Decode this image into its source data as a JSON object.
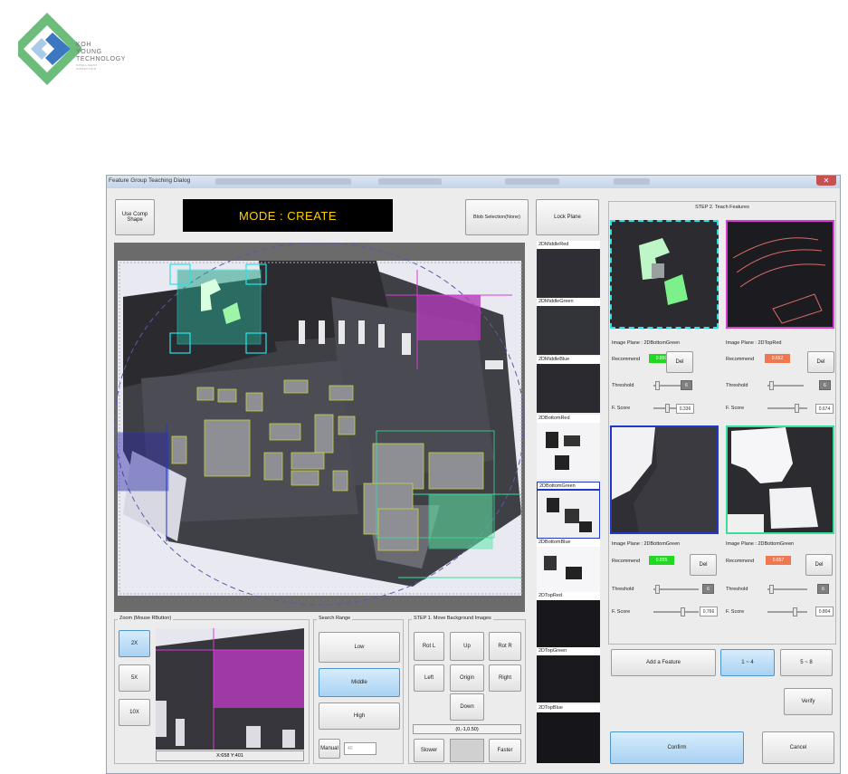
{
  "logo": {
    "line1": "KOH",
    "line2": "YOUNG",
    "line3": "TECHNOLOGY",
    "tag1": "INTELLIGENT",
    "tag2": "INSPECTION"
  },
  "window": {
    "title": "Feature Group Teaching Dialog",
    "close_icon": "close-icon",
    "title_extra": "Editor"
  },
  "toolbar": {
    "use_comp_shape": "Use Comp Shape",
    "mode": "MODE : CREATE",
    "blob_selection": "Blob Selection(None)",
    "lock_plane": "Lock Plane"
  },
  "zoom": {
    "label": "Zoom (Mouse RButton)",
    "buttons": [
      "2X",
      "5X",
      "10X"
    ],
    "coords": "X:658  Y:401"
  },
  "search_range": {
    "label": "Search Range",
    "buttons": [
      "Low",
      "Middle",
      "High"
    ],
    "manual": "Manual",
    "manual_value": "40"
  },
  "step1": {
    "label": "STEP 1. Move Background Images",
    "rot_l": "Rot L",
    "up": "Up",
    "rot_r": "Rot R",
    "left": "Left",
    "origin": "Origin",
    "right": "Right",
    "down": "Down",
    "offset": "(0,-1,0.50)",
    "slower": "Slower",
    "faster": "Faster"
  },
  "thumbnails": [
    "2DMiddleRed",
    "2DMiddleGreen",
    "2DMiddleBlue",
    "2DBottomRed",
    "2DBottomGreen",
    "2DBottomBlue",
    "2DTopRed",
    "2DTopGreen",
    "2DTopBlue"
  ],
  "step2": {
    "label": "STEP 2. Teach Features",
    "recommend_label": "Recommend",
    "del_label": "Del",
    "threshold_label": "Threshold",
    "fscore_label": "F. Score",
    "features": [
      {
        "plane": "Image Plane : 2DBottomGreen",
        "recommend": "0.850",
        "recommend_color": "#22d822",
        "threshold": "6",
        "fscore": "0.336",
        "border": "#27e3e8"
      },
      {
        "plane": "Image Plane : 2DTopRed",
        "recommend": "0.652",
        "recommend_color": "#f07850",
        "threshold": "6",
        "fscore": "0.674",
        "border": "#d63cd4"
      },
      {
        "plane": "Image Plane : 2DBottomGreen",
        "recommend": "0.835",
        "recommend_color": "#22d822",
        "threshold": "6",
        "fscore": "0.766",
        "border": "#2038c8"
      },
      {
        "plane": "Image Plane : 2DBottomGreen",
        "recommend": "0.657",
        "recommend_color": "#f07850",
        "threshold": "6",
        "fscore": "0.804",
        "border": "#36e09a"
      }
    ],
    "add_feature": "Add a Feature",
    "page1": "1 ~ 4",
    "page2": "5 ~ 8",
    "verify": "Verify",
    "confirm": "Confirm",
    "cancel": "Cancel"
  }
}
